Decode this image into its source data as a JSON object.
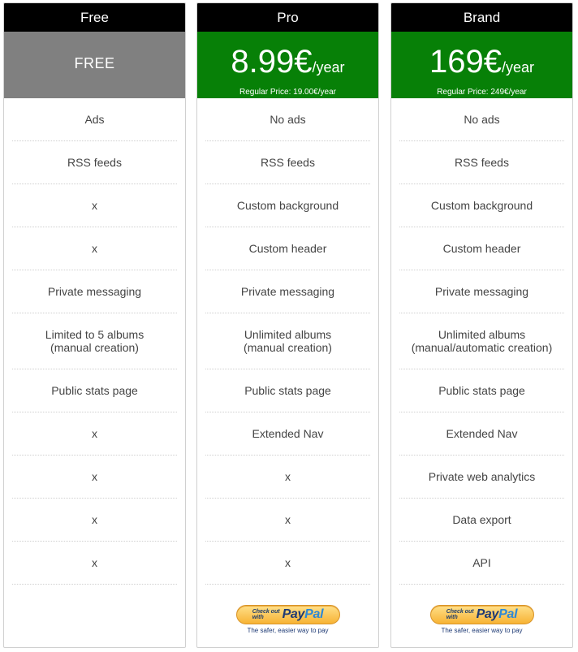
{
  "plans": [
    {
      "name": "Free",
      "price_label": "FREE",
      "features": [
        "Ads",
        "RSS feeds",
        "x",
        "x",
        "Private messaging",
        "Limited to 5 albums\n(manual creation)",
        "Public stats page",
        "x",
        "x",
        "x",
        "x"
      ]
    },
    {
      "name": "Pro",
      "price_amount": "8.99€",
      "price_period": "/year",
      "regular_price": "Regular Price: 19.00€/year",
      "features": [
        "No ads",
        "RSS feeds",
        "Custom background",
        "Custom header",
        "Private messaging",
        "Unlimited albums\n(manual creation)",
        "Public stats page",
        "Extended Nav",
        "x",
        "x",
        "x"
      ],
      "checkout": {
        "small_text": "Check out\nwith",
        "logo_pay": "Pay",
        "logo_pal": "Pal",
        "tagline": "The safer, easier way to pay"
      }
    },
    {
      "name": "Brand",
      "price_amount": "169€",
      "price_period": "/year",
      "regular_price": "Regular Price: 249€/year",
      "features": [
        "No ads",
        "RSS feeds",
        "Custom background",
        "Custom header",
        "Private messaging",
        "Unlimited albums\n(manual/automatic creation)",
        "Public stats page",
        "Extended Nav",
        "Private web analytics",
        "Data export",
        "API"
      ],
      "checkout": {
        "small_text": "Check out\nwith",
        "logo_pay": "Pay",
        "logo_pal": "Pal",
        "tagline": "The safer, easier way to pay"
      }
    }
  ],
  "colors": {
    "header_bg": "#000000",
    "free_price_bg": "#808080",
    "paid_price_bg": "#078007",
    "paypal_gold": "#f7b334"
  }
}
